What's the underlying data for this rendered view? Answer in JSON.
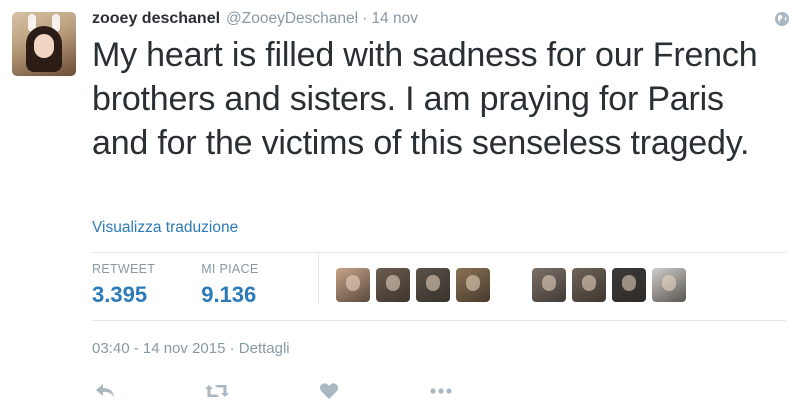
{
  "tweet": {
    "name": "zooey deschanel",
    "handle": "@ZooeyDeschanel",
    "separator": "·",
    "time": "14 nov",
    "text": "My heart is filled with sadness for our French brothers and sisters. I am praying for Paris and for the victims of this senseless tragedy.",
    "translate_label": "Visualizza traduzione",
    "datetime": "03:40 - 14 nov 2015 · Dettagli"
  },
  "stats": {
    "retweets_label": "RETWEET",
    "retweets_value": "3.395",
    "likes_label": "MI PIACE",
    "likes_value": "9.136"
  },
  "liker_avatars": [
    {
      "name": "liker-avatar-1",
      "color": "#c9a489"
    },
    {
      "name": "liker-avatar-2",
      "color": "#6b5d4f"
    },
    {
      "name": "liker-avatar-3",
      "color": "#5a5248"
    },
    {
      "name": "liker-avatar-4",
      "color": "#8a7152"
    },
    {
      "name": "liker-avatar-5",
      "color": "#7a7068"
    },
    {
      "name": "liker-avatar-6",
      "color": "#6e6458"
    },
    {
      "name": "liker-avatar-7",
      "color": "#3a3a3a"
    },
    {
      "name": "liker-avatar-8",
      "color": "#d0cdca"
    }
  ],
  "icons": {
    "globe": "globe-icon",
    "reply": "reply-icon",
    "retweet": "retweet-icon",
    "like": "heart-icon",
    "more": "more-icon"
  },
  "colors": {
    "link": "#2b7bb9",
    "muted": "#8899a6",
    "text": "#292f33",
    "icon": "#aab8c2"
  }
}
